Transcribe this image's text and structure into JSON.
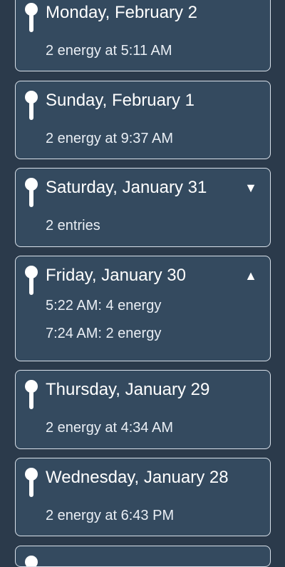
{
  "cards": [
    {
      "title": "Monday, February 2",
      "subtitle": "2 energy at 5:11 AM"
    },
    {
      "title": "Sunday, February 1",
      "subtitle": "2 energy at 9:37 AM"
    },
    {
      "title": "Saturday, January 31",
      "subtitle": "2 entries",
      "toggle": "▼"
    },
    {
      "title": "Friday, January 30",
      "toggle": "▲",
      "entries": [
        "5:22 AM: 4 energy",
        "7:24 AM: 2 energy"
      ]
    },
    {
      "title": "Thursday, January 29",
      "subtitle": "2 energy at 4:34 AM"
    },
    {
      "title": "Wednesday, January 28",
      "subtitle": "2 energy at 6:43 PM"
    }
  ]
}
